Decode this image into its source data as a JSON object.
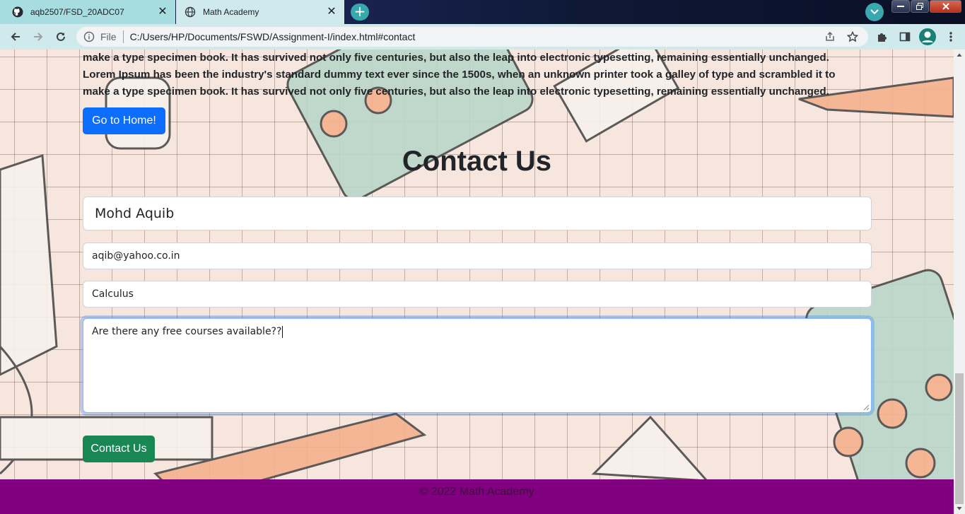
{
  "browser": {
    "tabs": [
      {
        "title": "aqb2507/FSD_20ADC07",
        "icon": "github-icon",
        "active": false
      },
      {
        "title": "Math Academy",
        "icon": "globe-icon",
        "active": true
      }
    ],
    "close_glyph": "✕",
    "new_tab_glyph": "+",
    "address": {
      "scheme_label": "File",
      "url": "C:/Users/HP/Documents/FSWD/Assignment-I/index.html#contact"
    }
  },
  "page": {
    "intro_lines": [
      "make a type specimen book. It has survived not only five centuries, but also the leap into electronic typesetting, remaining essentially unchanged.",
      "Lorem Ipsum has been the industry's standard dummy text ever since the 1500s, when an unknown printer took a galley of type and scrambled it to",
      "make a type specimen book. It has survived not only five centuries, but also the leap into electronic typesetting, remaining essentially unchanged."
    ],
    "home_button": "Go to Home!",
    "contact_title": "Contact Us",
    "form": {
      "name": "Mohd Aquib",
      "email": "aqib@yahoo.co.in",
      "subject": "Calculus",
      "message": "Are there any free courses available??"
    },
    "submit_button": "Contact Us",
    "footer": "© 2022 Math Academy"
  },
  "colors": {
    "primary_button": "#0d6efd",
    "success_button": "#198754",
    "footer_bg": "#800080"
  }
}
